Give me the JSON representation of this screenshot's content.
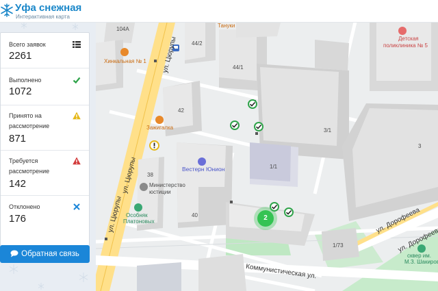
{
  "header": {
    "title": "Уфа снежная",
    "subtitle": "Интерактивная карта",
    "logo_icon": "snowflake-icon",
    "accent": "#1a87c9"
  },
  "stats": [
    {
      "label_line1": "Всего заявок",
      "label_line2": "",
      "value": "2261",
      "icon": "list-icon",
      "color": "#333333"
    },
    {
      "label_line1": "Выполнено",
      "label_line2": "",
      "value": "1072",
      "icon": "check-icon",
      "color": "#2fa34a"
    },
    {
      "label_line1": "Принято на",
      "label_line2": "рассмотрение",
      "value": "871",
      "icon": "warning-icon",
      "color": "#e5b81a"
    },
    {
      "label_line1": "Требуется",
      "label_line2": "рассмотрение",
      "value": "142",
      "icon": "alert-icon",
      "color": "#d23b3b"
    },
    {
      "label_line1": "Отклонено",
      "label_line2": "",
      "value": "176",
      "icon": "close-icon",
      "color": "#1b86d8"
    }
  ],
  "feedback": {
    "label": "Обратная связь",
    "icon": "chat-icon",
    "color": "#1b86d8"
  },
  "map": {
    "buildings": [
      "104А",
      "44/2",
      "44/1",
      "42",
      "38",
      "40",
      "1/1",
      "3/1",
      "3",
      "1/73"
    ],
    "streets": [
      "ул. Цюрупы",
      "ул. Цюрупы",
      "ул. Цюрупы",
      "ул. Дорофеева",
      "ул. Дорофеева",
      "Коммунистическая ул."
    ],
    "pois": {
      "tanuki": "Тануки",
      "clinic_line1": "Детская",
      "clinic_line2": "поликлиника № 5",
      "hinkalnaya": "Хинкальная № 1",
      "zazhigalka": "Зажигалка",
      "western_union": "Вестерн Юнион",
      "ministry_line1": "Министерство",
      "ministry_line2": "юстиции",
      "osobnyak_line1": "Особняк",
      "osobnyak_line2": "Платоновых",
      "skver_line1": "сквер им.",
      "skver_line2": "М.З. Шакирова"
    },
    "cluster_count": "2"
  }
}
